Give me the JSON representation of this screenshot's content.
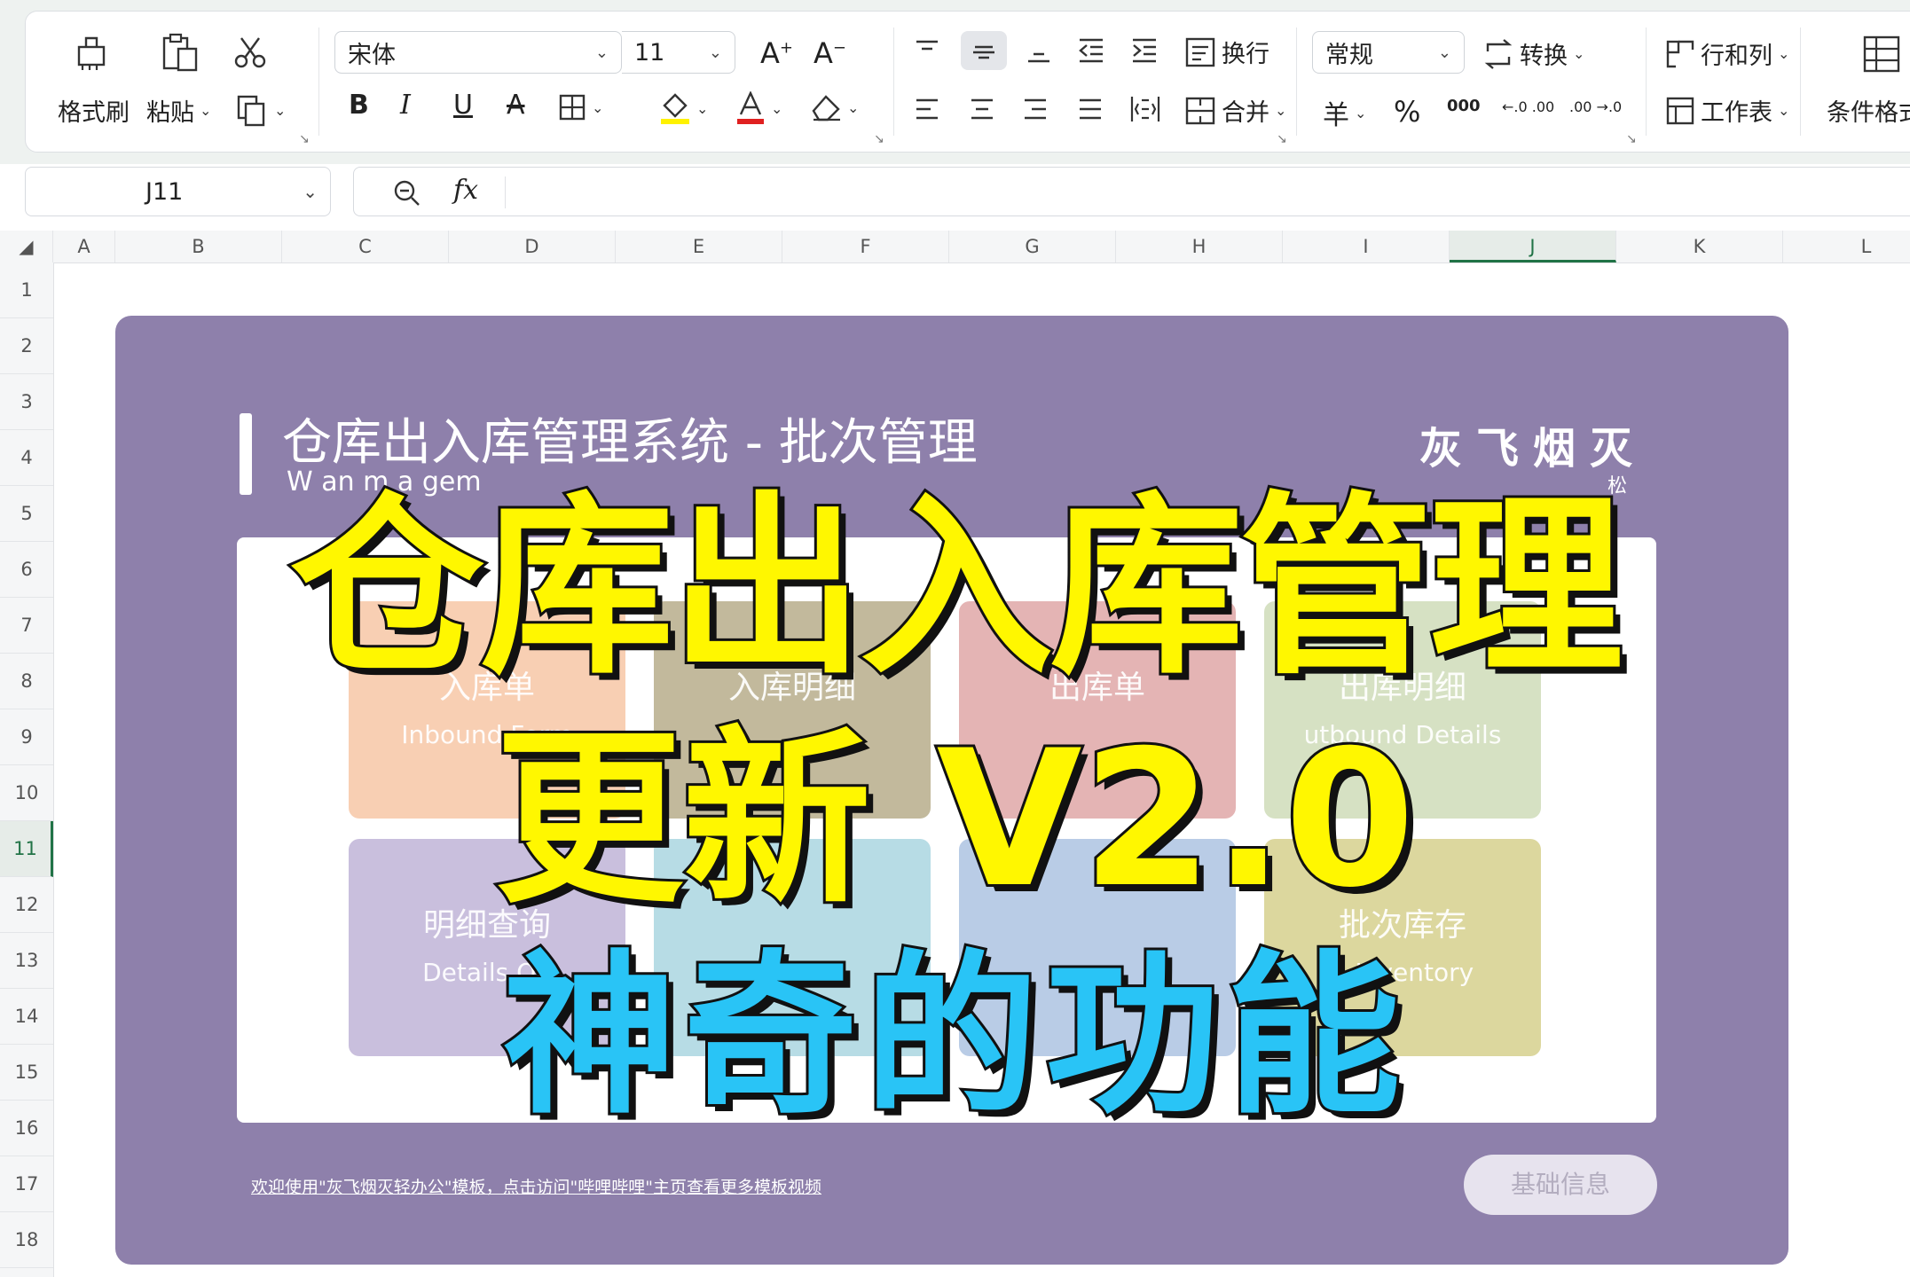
{
  "ribbon": {
    "format_painter": "格式刷",
    "paste": "粘贴",
    "font_name": "宋体",
    "font_size": "11",
    "wrap": "换行",
    "merge": "合并",
    "number_format": "常规",
    "convert": "转换",
    "rows_cols": "行和列",
    "worksheet": "工作表",
    "cond_format": "条件格式",
    "currency_symbol": "羊",
    "percent_symbol": "%",
    "thousands_symbol": "000",
    "inc_decimal": "←.0 .00",
    "dec_decimal": ".00 →.0"
  },
  "formula_bar": {
    "cell_ref": "J11",
    "fx_label": "fx"
  },
  "grid": {
    "columns": [
      "A",
      "B",
      "C",
      "D",
      "E",
      "F",
      "G",
      "H",
      "I",
      "J",
      "K",
      "L"
    ],
    "rows": [
      "1",
      "2",
      "3",
      "4",
      "5",
      "6",
      "7",
      "8",
      "9",
      "10",
      "11",
      "12",
      "13",
      "14",
      "15",
      "16",
      "17",
      "18"
    ],
    "active_column": "J",
    "active_row": "11"
  },
  "dashboard": {
    "title": "仓库出入库管理系统 - 批次管理",
    "subtitle": "W          an          m          a          gem",
    "brand": "灰飞烟灭",
    "brand_small": "松",
    "tiles": [
      {
        "zh": "入库单",
        "en": "Inbound Form",
        "color": "#f8cfb3"
      },
      {
        "zh": "入库明细",
        "en": "",
        "color": "#c2b99c"
      },
      {
        "zh": "出库单",
        "en": "",
        "color": "#e4b4b4"
      },
      {
        "zh": "出库明细",
        "en": "utbound Details",
        "color": "#d6e1c3"
      },
      {
        "zh": "明细查询",
        "en": "Details Qu",
        "color": "#c9bfdd"
      },
      {
        "zh": "",
        "en": "",
        "color": "#b7dce5"
      },
      {
        "zh": "",
        "en": "",
        "color": "#b9cce6"
      },
      {
        "zh": "批次库存",
        "en": "h Inventory",
        "color": "#dcd79e"
      }
    ],
    "footer": "欢迎使用\"灰飞烟灭轻办公\"模板，点击访问\"哔哩哔哩\"主页查看更多模板视频",
    "button": "基础信息"
  },
  "overlay": {
    "line1": "仓库出入库管理",
    "line2": "更新 V2.0",
    "line3": "神奇的功能",
    "color_yellow": "#fff700",
    "color_blue": "#29c4f6"
  },
  "icons": [
    "format-painter-icon",
    "paste-icon",
    "cut-icon",
    "copy-icon",
    "bold-icon",
    "italic-icon",
    "underline-icon",
    "strikethrough-icon",
    "border-icon",
    "fill-color-icon",
    "font-color-icon",
    "clear-icon",
    "align-top-icon",
    "align-middle-icon",
    "align-bottom-icon",
    "indent-decrease-icon",
    "indent-increase-icon",
    "wrap-icon",
    "align-left-icon",
    "align-center-icon",
    "align-right-icon",
    "justify-icon",
    "distributed-icon",
    "merge-icon",
    "convert-icon",
    "rows-cols-icon",
    "worksheet-icon",
    "conditional-format-icon",
    "zoom-icon"
  ]
}
